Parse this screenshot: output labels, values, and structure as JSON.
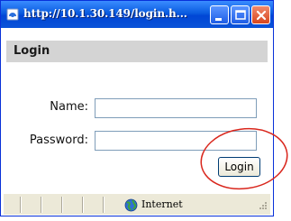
{
  "window": {
    "title": "http://10.1.30.149/login.h...",
    "icon": "ie-page-icon",
    "controls": [
      "minimize-icon",
      "maximize-icon",
      "close-icon"
    ]
  },
  "form": {
    "header": "Login",
    "name_label": "Name:",
    "name_value": "",
    "password_label": "Password:",
    "password_value": "",
    "submit_label": "Login"
  },
  "status": {
    "zone_text": "Internet",
    "zone_icon": "globe-icon"
  },
  "colors": {
    "titlebar": "#0a5ce0",
    "header_bg": "#d4d4d4",
    "annotation": "#d9261c"
  }
}
